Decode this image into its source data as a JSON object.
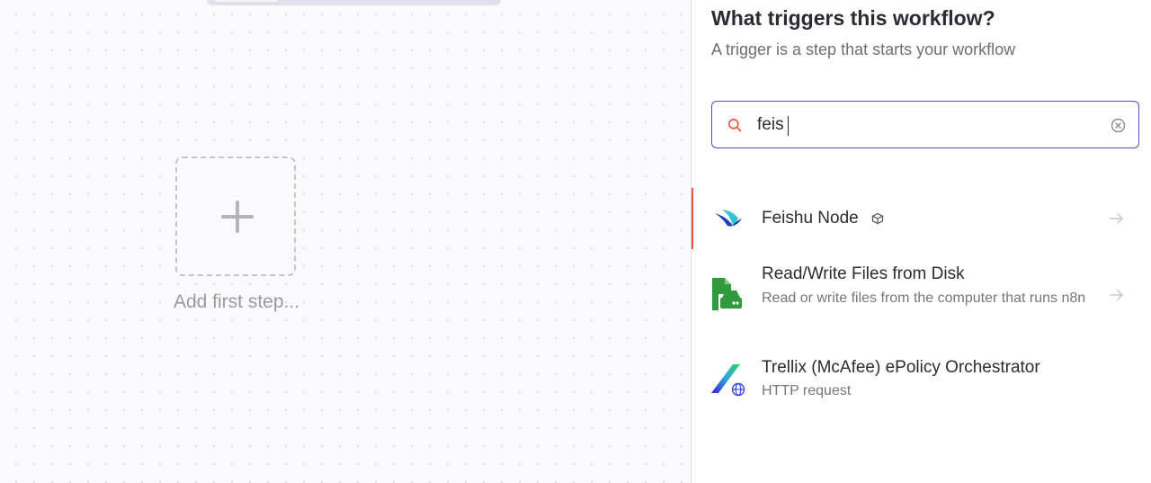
{
  "canvas": {
    "add_first_step_label": "Add first step..."
  },
  "panel": {
    "title": "What triggers this workflow?",
    "subtitle": "A trigger is a step that starts your workflow",
    "search": {
      "value": "feis",
      "placeholder": "Search nodes..."
    },
    "results": [
      {
        "title": "Feishu Node",
        "description": "",
        "icon": "feishu-bird-icon",
        "badge": "community-node-icon",
        "active": true
      },
      {
        "title": "Read/Write Files from Disk",
        "description": "Read or write files from the computer that runs n8n",
        "icon": "disk-file-icon"
      },
      {
        "title": "Trellix (McAfee) ePolicy Orchestrator",
        "description": "HTTP request",
        "icon": "trellix-icon"
      }
    ]
  },
  "colors": {
    "accent": "#5a48d4",
    "active_indicator": "#f0513a",
    "search_icon": "#f0513a",
    "files_green": "#2f9b3c"
  }
}
